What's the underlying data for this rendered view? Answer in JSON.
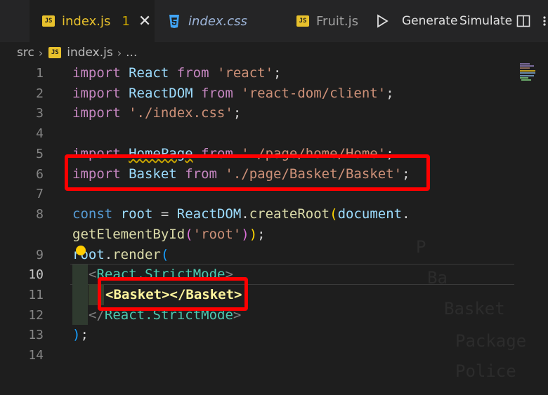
{
  "tabs": [
    {
      "label": "index.js",
      "badge": "JS",
      "problems": "1",
      "close": "✕"
    },
    {
      "label": "index.css"
    },
    {
      "label": "Fruit.js",
      "badge": "JS"
    }
  ],
  "toolbar": {
    "generate": "Generate",
    "simulate": "Simulate"
  },
  "breadcrumb": {
    "folder": "src",
    "badge": "JS",
    "file": "index.js",
    "tail": "..."
  },
  "code": {
    "line1": {
      "kw": "import",
      "id": "React",
      "from": "from",
      "str": "'react'",
      "end": ";"
    },
    "line2": {
      "kw": "import",
      "id": "ReactDOM",
      "from": "from",
      "str": "'react-dom/client'",
      "end": ";"
    },
    "line3": {
      "kw": "import",
      "str": "'./index.css'",
      "end": ";"
    },
    "line5": {
      "kw": "import",
      "id": "HomePage",
      "from": "from",
      "str": "'./page/home/Home'",
      "end": ";"
    },
    "line6": {
      "kw": "import",
      "id": "Basket",
      "from": "from",
      "str": "'./page/Basket/Basket'",
      "end": ";"
    },
    "line8": {
      "kw": "const",
      "id": "root",
      "eq": " = ",
      "obj": "ReactDOM",
      "dot": ".",
      "fn": "createRoot",
      "open": "(",
      "arg": "document",
      "dot2": "."
    },
    "line8b": {
      "fn": "getElementById",
      "open": "(",
      "str": "'root'",
      "close1": ")",
      "close2": ")",
      "end": ";"
    },
    "line9": {
      "id": "root",
      "dot": ".",
      "fn": "render",
      "open": "("
    },
    "line10": {
      "open": "<",
      "tag": "React.StrictMode",
      "close": ">"
    },
    "line11": {
      "text": "<Basket></Basket>"
    },
    "line12": {
      "open": "</",
      "tag": "React.StrictMode",
      "close": ">"
    },
    "line13": {
      "close": ")",
      "end": ";"
    }
  },
  "line_numbers": [
    "1",
    "2",
    "3",
    "4",
    "5",
    "6",
    "7",
    "8",
    "9",
    "10",
    "11",
    "12",
    "13",
    "14"
  ],
  "ghost_text": [
    "P",
    "Ba",
    "Basket",
    "Package",
    "Police"
  ]
}
